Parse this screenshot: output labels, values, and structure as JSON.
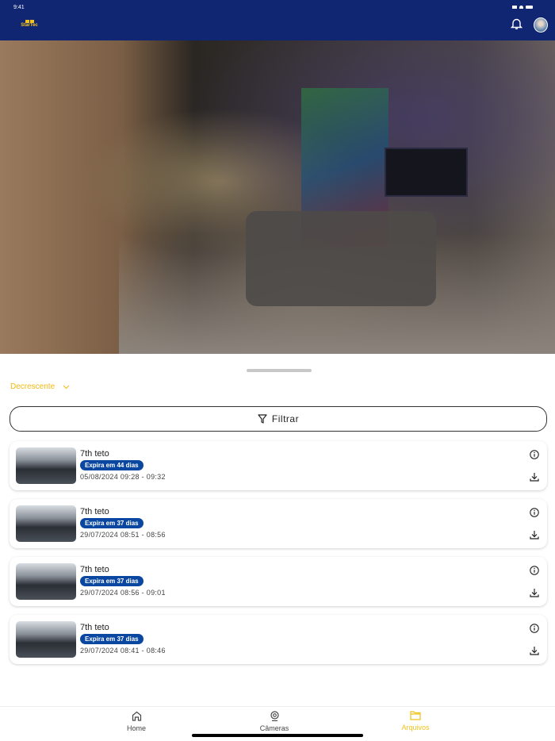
{
  "status_bar": {
    "time": "9:41"
  },
  "header": {
    "logo_text": "StarTec",
    "colors": {
      "background": "#112673",
      "accent": "#f4c21a"
    }
  },
  "sort": {
    "label": "Decrescente"
  },
  "filter": {
    "label": "Filtrar"
  },
  "recordings": [
    {
      "title": "7th teto",
      "badge": "Expira em 44 dias",
      "time": "05/08/2024 09:28 -  09:32"
    },
    {
      "title": "7th teto",
      "badge": "Expira em 37 dias",
      "time": "29/07/2024 08:51 -  08:56"
    },
    {
      "title": "7th teto",
      "badge": "Expira em 37 dias",
      "time": "29/07/2024 08:56 -  09:01"
    },
    {
      "title": "7th teto",
      "badge": "Expira em 37 dias",
      "time": "29/07/2024 08:41 -  08:46"
    }
  ],
  "tabs": [
    {
      "label": "Home"
    },
    {
      "label": "Câmeras"
    },
    {
      "label": "Arquivos",
      "active": true
    }
  ]
}
